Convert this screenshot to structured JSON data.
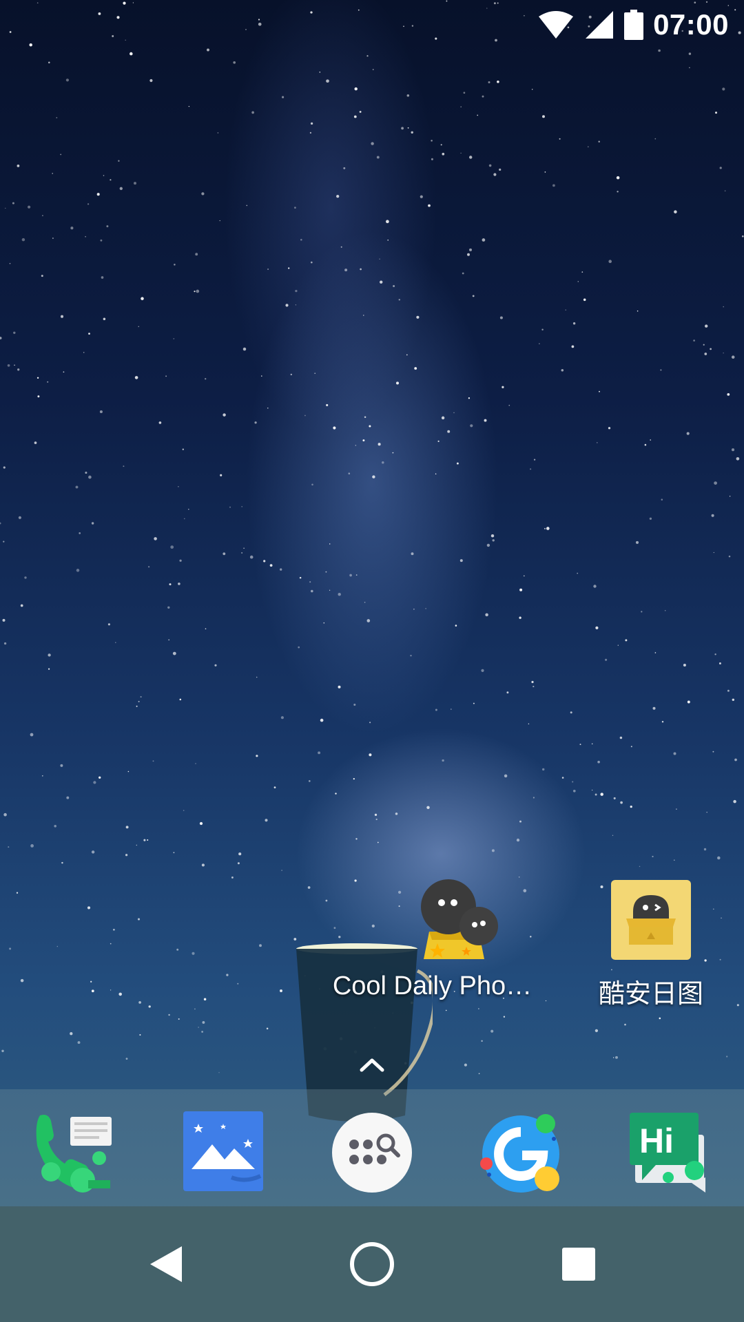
{
  "status_bar": {
    "time": "07:00",
    "icons": [
      "wifi-icon",
      "cellular-signal-icon",
      "battery-icon"
    ]
  },
  "home_screen": {
    "apps": [
      {
        "label": "Cool Daily Pho…",
        "icon": "cool-daily-photo-icon"
      },
      {
        "label": "酷安日图",
        "icon": "coolapk-daily-image-icon"
      }
    ],
    "app_drawer_hint_icon": "chevron-up-icon"
  },
  "dock": {
    "items": [
      {
        "icon": "phone-messages-icon"
      },
      {
        "icon": "gallery-mountains-icon"
      },
      {
        "icon": "app-search-icon"
      },
      {
        "icon": "google-g-icon"
      },
      {
        "icon": "hi-chat-icon"
      }
    ]
  },
  "nav_bar": {
    "buttons": [
      "back-icon",
      "home-icon",
      "recents-icon"
    ]
  },
  "colors": {
    "dock_bg": "#6f8f98",
    "nav_bg": "#44626a",
    "phone_green": "#21c162",
    "gallery_blue": "#3f7ee8",
    "hi_green": "#1aa16a",
    "daily_yellow": "#f3d774"
  }
}
